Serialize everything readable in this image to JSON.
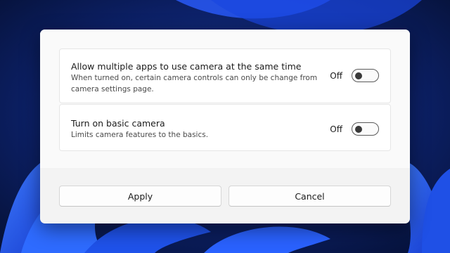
{
  "settings": [
    {
      "title": "Allow multiple apps to use camera at the same time",
      "description": "When turned on, certain camera controls can only be change from camera settings page.",
      "state": "Off",
      "on": false
    },
    {
      "title": "Turn on basic camera",
      "description": "Limits camera features to the basics.",
      "state": "Off",
      "on": false
    }
  ],
  "buttons": {
    "apply": "Apply",
    "cancel": "Cancel"
  },
  "colors": {
    "wallpaper_dark": "#0a1a4a",
    "wallpaper_bloom": "#1f5bff",
    "dialog_bg": "#f3f3f3",
    "card_bg": "#ffffff"
  }
}
